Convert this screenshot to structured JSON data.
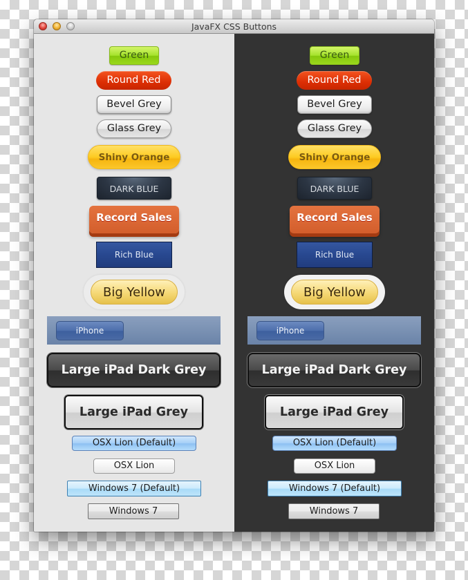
{
  "window": {
    "title": "JavaFX CSS Buttons",
    "controls": [
      "close",
      "minimize",
      "zoom"
    ]
  },
  "panes": {
    "light": {
      "theme": "light",
      "background": "#e6e6e6"
    },
    "dark": {
      "theme": "dark",
      "background": "#333333"
    }
  },
  "buttons": {
    "green": "Green",
    "round_red": "Round Red",
    "bevel_grey": "Bevel Grey",
    "glass_grey": "Glass Grey",
    "shiny_orange": "Shiny Orange",
    "dark_blue": "DARK BLUE",
    "record_sales": "Record Sales",
    "rich_blue": "Rich Blue",
    "big_yellow": "Big Yellow",
    "iphone": "iPhone",
    "large_ipad_dark_grey": "Large iPad Dark Grey",
    "large_ipad_grey": "Large iPad Grey",
    "osx_lion_default": "OSX Lion (Default)",
    "osx_lion": "OSX Lion",
    "windows7_default": "Windows 7 (Default)",
    "windows7": "Windows 7"
  },
  "colors": {
    "green": "#a4e22b",
    "round_red": "#dc2e04",
    "shiny_orange": "#fdcb22",
    "dark_blue": "#2c3644",
    "record_sales": "#d35e2c",
    "rich_blue": "#284890",
    "big_yellow": "#f5d875",
    "iphone_bar": "#6a83a8"
  }
}
